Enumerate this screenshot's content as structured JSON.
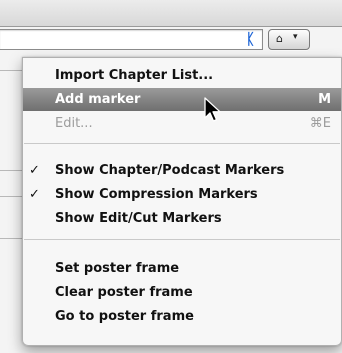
{
  "marker_button": {
    "icon": "marker-pin-icon",
    "glyph": "⌂",
    "caret": "▾",
    "flag": "ᛕ"
  },
  "menu": {
    "items": [
      {
        "label": "Import Chapter List...",
        "shortcut": "",
        "checked": false,
        "state": "normal"
      },
      {
        "label": "Add marker",
        "shortcut": "M",
        "checked": false,
        "state": "highlighted"
      },
      {
        "label": "Edit...",
        "shortcut": "⌘E",
        "checked": false,
        "state": "disabled"
      },
      {
        "label": "Show Chapter/Podcast Markers",
        "shortcut": "",
        "checked": true,
        "state": "normal"
      },
      {
        "label": "Show Compression Markers",
        "shortcut": "",
        "checked": true,
        "state": "normal"
      },
      {
        "label": "Show Edit/Cut Markers",
        "shortcut": "",
        "checked": false,
        "state": "normal"
      },
      {
        "label": "Set poster frame",
        "shortcut": "",
        "checked": false,
        "state": "normal"
      },
      {
        "label": "Clear poster frame",
        "shortcut": "",
        "checked": false,
        "state": "normal"
      },
      {
        "label": "Go to poster frame",
        "shortcut": "",
        "checked": false,
        "state": "normal"
      }
    ],
    "check_glyph": "✓"
  },
  "colors": {
    "highlight": "#7f7f7f",
    "marker_blue": "#1c64d6",
    "disabled_text": "#9c9c9c"
  }
}
